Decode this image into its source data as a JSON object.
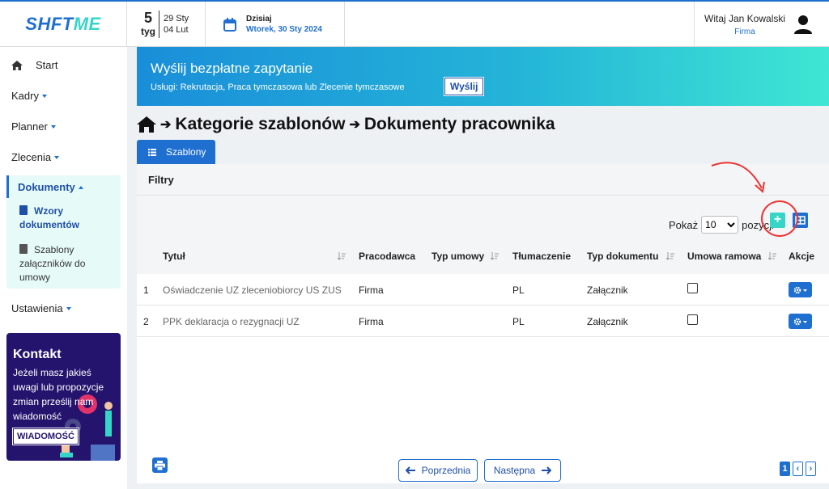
{
  "logo": {
    "part1": "SHFT",
    "part2": "ME"
  },
  "week": {
    "number": "5",
    "label": "tyg",
    "date_from": "29 Sty",
    "date_to": "04 Lut"
  },
  "today": {
    "label": "Dzisiaj",
    "date": "Wtorek, 30 Sty 2024"
  },
  "user": {
    "greeting": "Witaj Jan Kowalski",
    "company": "Firma"
  },
  "sidebar": {
    "start": "Start",
    "kadry": "Kadry",
    "planner": "Planner",
    "zlecenia": "Zlecenia",
    "dokumenty": "Dokumenty",
    "wzory": "Wzory dokumentów",
    "szablony": "Szablony załączników do umowy",
    "ustawienia": "Ustawienia"
  },
  "contact": {
    "title": "Kontakt",
    "text": "Jeżeli masz jakieś uwagi lub propozycje zmian prześlij nam wiadomość",
    "button": "WIADOMOŚĆ"
  },
  "banner": {
    "title": "Wyślij bezpłatne zapytanie",
    "services": "Usługi: Rekrutacja, Praca tymczasowa lub Zlecenie tymczasowe",
    "button": "Wyślij"
  },
  "breadcrumb": {
    "level1": "Kategorie szablonów",
    "level2": "Dokumenty pracownika"
  },
  "tab": "Szablony",
  "filters": "Filtry",
  "show": {
    "label_before": "Pokaż",
    "value": "10",
    "label_after": "pozycji"
  },
  "table": {
    "headers": [
      "Tytuł",
      "Pracodawca",
      "Typ umowy",
      "Tłumaczenie",
      "Typ dokumentu",
      "Umowa ramowa",
      "Akcje"
    ],
    "rows": [
      {
        "no": "1",
        "title": "Oświadczenie UZ zleceniobiorcy US ZUS",
        "employer": "Firma",
        "contract_type": "",
        "translation": "PL",
        "doc_type": "Załącznik",
        "framework": false
      },
      {
        "no": "2",
        "title": "PPK deklaracja o rezygnacji UZ",
        "employer": "Firma",
        "contract_type": "",
        "translation": "PL",
        "doc_type": "Załącznik",
        "framework": false
      }
    ]
  },
  "pagination": {
    "prev": "Poprzednia",
    "next": "Następna",
    "current": "1"
  },
  "colors": {
    "primary": "#1f6fd1",
    "accent": "#35d6c8",
    "contact_bg": "#25146e",
    "annotation": "#e33333"
  }
}
